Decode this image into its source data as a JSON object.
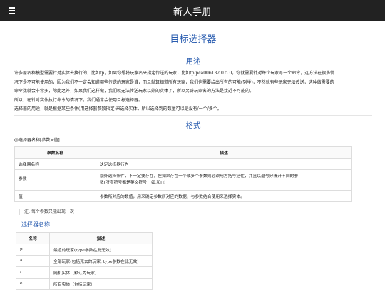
{
  "header": {
    "title": "新人手册"
  },
  "page": {
    "title": "目标选择器"
  },
  "usage": {
    "heading": "用途",
    "p1_line1": "许多原名称模型需要针对实体去执行的，比如tp，如果你想将玩家名来指定传送的玩家，比如tp pca006132 0 5 0，你就需要针对每个玩家写一个命令，这方法在很多情",
    "p1_line2": "况下是不可能使用的，因为我们不一定会知道哪些传送的玩家是谁，而且就算知道所有玩家，我们也需要给出所有的可能(列举)，不然就有些玩家无法传送，这种做需要的",
    "p1_line3": "命令数就会非常多，除此之外，如果我们这样做，我们就无法传送玩家以外的实体了，所以另辟玩家名的方法是接近不可能的。",
    "p2_line1": "所以，在针对实体执行命令的情况下，我们通常会使用目标选择器。",
    "p2_line2": "选择器的用途，就是根据某些条件(用选择器参数指定)来选择实体，所以选择到的数量可以是没有/一个/多个。"
  },
  "format": {
    "heading": "格式",
    "syntax": "@选择器名称[参数=值]",
    "table": {
      "headers": [
        "参数名称",
        "描述"
      ],
      "rows": [
        {
          "name": "选择器名称",
          "desc": "决定选择器行为",
          "desc2": ""
        },
        {
          "name": "参数",
          "desc": "额外选择条件，不一定要存在，但如果存在一个或多个参数则必须用方括号括住，并且以逗号分隔开不同的参",
          "desc2": "数(所有符号都是英文符号，如,和[])"
        },
        {
          "name": "值",
          "desc": "参数所对应的数值，用来确定参数所对应的数据，与参数结合使用来选择实体。",
          "desc2": ""
        }
      ]
    },
    "note": "注: 每个参数只能出现一次"
  },
  "selector_names": {
    "heading": "选择器名称",
    "headers": [
      "名称",
      "描述"
    ],
    "rows": [
      {
        "name": "p",
        "desc": "最近的玩家(type参数在此无效)"
      },
      {
        "name": "a",
        "desc": "全部玩家(包括死去的玩家, type参数在此无效)"
      },
      {
        "name": "r",
        "desc": "随机实体（默认为玩家）"
      },
      {
        "name": "e",
        "desc": "所有实体（包括玩家）"
      }
    ]
  }
}
